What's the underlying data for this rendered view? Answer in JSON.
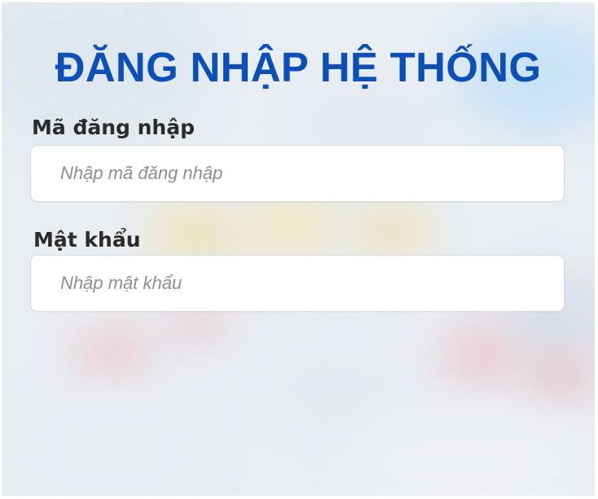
{
  "login": {
    "title": "ĐĂNG NHẬP HỆ THỐNG",
    "username_label": "Mã đăng nhập",
    "username_placeholder": "Nhập mã đăng nhập",
    "password_label": "Mật khẩu",
    "password_placeholder": "Nhập mật khẩu"
  },
  "colors": {
    "title": "#0b4fb7",
    "label": "#2b2b2b",
    "placeholder": "#8a8f96",
    "input_bg": "#ffffff",
    "page_bg": "#e9eef3"
  }
}
